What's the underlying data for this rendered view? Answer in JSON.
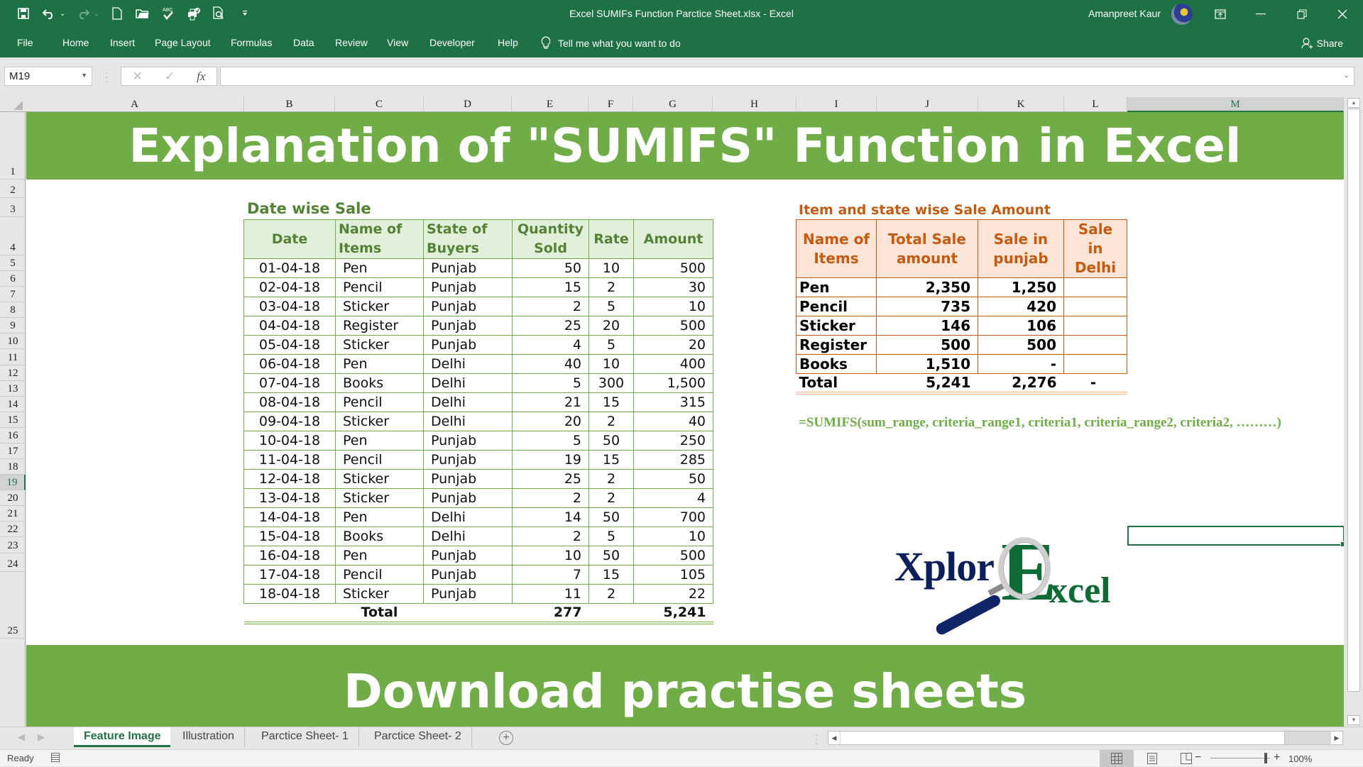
{
  "window": {
    "title": "Excel SUMIFs Function Parctice Sheet.xlsx  -  Excel",
    "user": "Amanpreet Kaur",
    "controls": {
      "ribbon_display": "▣",
      "minimize": "—",
      "restore": "❐",
      "close": "✕"
    }
  },
  "qat": {
    "save": "💾",
    "undo": "↶",
    "redo": "↷",
    "new": "🗋",
    "open": "📂",
    "spelling": "ABC✓",
    "quickprint": "🖶",
    "preview": "🔍",
    "customize": "⯆"
  },
  "ribbon": {
    "tabs": [
      "File",
      "Home",
      "Insert",
      "Page Layout",
      "Formulas",
      "Data",
      "Review",
      "View",
      "Developer",
      "Help"
    ],
    "tell_me": "Tell me what you want to do",
    "share": "Share"
  },
  "formula_bar": {
    "name_box": "M19",
    "cancel": "✕",
    "enter": "✓",
    "fx": "fx",
    "value": ""
  },
  "columns": [
    "A",
    "B",
    "C",
    "D",
    "E",
    "F",
    "G",
    "H",
    "I",
    "J",
    "K",
    "L",
    "M"
  ],
  "selected_column": "M",
  "rows": [
    "1",
    "2",
    "3",
    "4",
    "5",
    "6",
    "7",
    "8",
    "9",
    "10",
    "11",
    "12",
    "13",
    "14",
    "15",
    "16",
    "17",
    "18",
    "19",
    "20",
    "21",
    "22",
    "23",
    "24",
    "25"
  ],
  "selected_row": "19",
  "sheet": {
    "banner_top": "Explanation of \"SUMIFS\" Function in Excel",
    "banner_bottom": "Download practise sheets",
    "table1": {
      "title": "Date wise Sale",
      "headers": [
        "Date",
        "Name of Items",
        "State of Buyers",
        "Quantity Sold",
        "Rate",
        "Amount"
      ],
      "rows": [
        [
          "01-04-18",
          "Pen",
          "Punjab",
          "50",
          "10",
          "500"
        ],
        [
          "02-04-18",
          "Pencil",
          "Punjab",
          "15",
          "2",
          "30"
        ],
        [
          "03-04-18",
          "Sticker",
          "Punjab",
          "2",
          "5",
          "10"
        ],
        [
          "04-04-18",
          "Register",
          "Punjab",
          "25",
          "20",
          "500"
        ],
        [
          "05-04-18",
          "Sticker",
          "Punjab",
          "4",
          "5",
          "20"
        ],
        [
          "06-04-18",
          "Pen",
          "Delhi",
          "40",
          "10",
          "400"
        ],
        [
          "07-04-18",
          "Books",
          "Delhi",
          "5",
          "300",
          "1,500"
        ],
        [
          "08-04-18",
          "Pencil",
          "Delhi",
          "21",
          "15",
          "315"
        ],
        [
          "09-04-18",
          "Sticker",
          "Delhi",
          "20",
          "2",
          "40"
        ],
        [
          "10-04-18",
          "Pen",
          "Punjab",
          "5",
          "50",
          "250"
        ],
        [
          "11-04-18",
          "Pencil",
          "Punjab",
          "19",
          "15",
          "285"
        ],
        [
          "12-04-18",
          "Sticker",
          "Punjab",
          "25",
          "2",
          "50"
        ],
        [
          "13-04-18",
          "Sticker",
          "Punjab",
          "2",
          "2",
          "4"
        ],
        [
          "14-04-18",
          "Pen",
          "Delhi",
          "14",
          "50",
          "700"
        ],
        [
          "15-04-18",
          "Books",
          "Delhi",
          "2",
          "5",
          "10"
        ],
        [
          "16-04-18",
          "Pen",
          "Punjab",
          "10",
          "50",
          "500"
        ],
        [
          "17-04-18",
          "Pencil",
          "Punjab",
          "7",
          "15",
          "105"
        ],
        [
          "18-04-18",
          "Sticker",
          "Punjab",
          "11",
          "2",
          "22"
        ]
      ],
      "total": {
        "label": "Total",
        "quantity": "277",
        "amount": "5,241"
      }
    },
    "table2": {
      "title": "Item and state wise Sale Amount",
      "headers": [
        "Name of Items",
        "Total Sale amount",
        "Sale in punjab",
        "Sale in Delhi"
      ],
      "rows": [
        [
          "Pen",
          "2,350",
          "1,250",
          ""
        ],
        [
          "Pencil",
          "735",
          "420",
          ""
        ],
        [
          "Sticker",
          "146",
          "106",
          ""
        ],
        [
          "Register",
          "500",
          "500",
          ""
        ],
        [
          "Books",
          "1,510",
          "-",
          ""
        ]
      ],
      "total": [
        "Total",
        "5,241",
        "2,276",
        "-"
      ]
    },
    "formula_text": "=SUMIFS(sum_range, criteria_range1, criteria1, criteria_range2, criteria2, ………)",
    "logo": {
      "part1": "Xplor",
      "part2": "E",
      "part3": "xcel"
    }
  },
  "sheet_tabs": [
    "Feature Image",
    "Illustration",
    "Parctice Sheet- 1",
    "Parctice Sheet- 2"
  ],
  "active_sheet": "Feature Image",
  "status": {
    "mode": "Ready",
    "zoom": "100%",
    "zoom_level_percent": 100
  },
  "colors": {
    "excel_green": "#1e7145",
    "banner_green": "#70ad47",
    "table1_text": "#548235",
    "table2_text": "#c55a11",
    "table2_header_bg": "#fce4d6",
    "table1_header_bg": "#e2efda"
  }
}
